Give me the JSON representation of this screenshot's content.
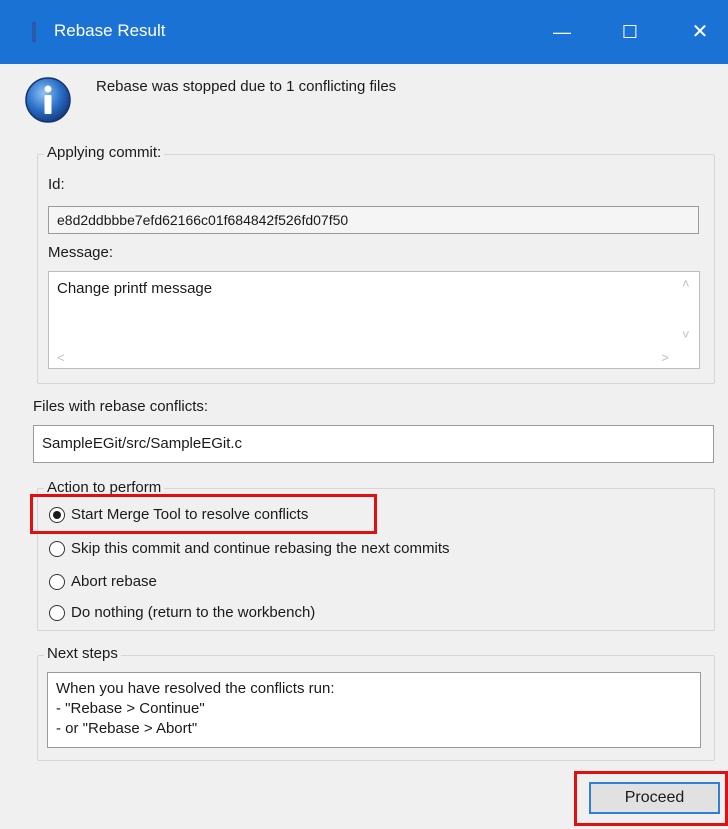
{
  "window": {
    "title": "Rebase Result",
    "controls": {
      "minimize": "—",
      "maximize": "☐",
      "close": "✕"
    }
  },
  "header": {
    "icon": "info-icon",
    "message": "Rebase was stopped due to 1 conflicting files"
  },
  "applying_commit": {
    "group_label": "Applying commit:",
    "id_label": "Id:",
    "id_value": "e8d2ddbbbe7efd62166c01f684842f526fd07f50",
    "message_label": "Message:",
    "message_value": "Change printf message",
    "scroll_arrows": {
      "up": "˄",
      "down": "˅",
      "left": "<",
      "right": ">"
    }
  },
  "conflicts": {
    "label": "Files with rebase conflicts:",
    "value": "SampleEGit/src/SampleEGit.c"
  },
  "actions": {
    "group_label": "Action to perform",
    "selected": 0,
    "options": [
      "Start Merge Tool to resolve conflicts",
      "Skip this commit and continue rebasing the next commits",
      "Abort rebase",
      "Do nothing (return to the workbench)"
    ]
  },
  "next_steps": {
    "group_label": "Next steps",
    "lines": [
      "When you have resolved the conflicts run:",
      "- \"Rebase > Continue\"",
      "- or \"Rebase > Abort\""
    ]
  },
  "buttons": {
    "proceed": "Proceed"
  },
  "colors": {
    "titlebar": "#1a73d4",
    "highlight": "#e01010",
    "info_icon": "#1f5fb5"
  }
}
